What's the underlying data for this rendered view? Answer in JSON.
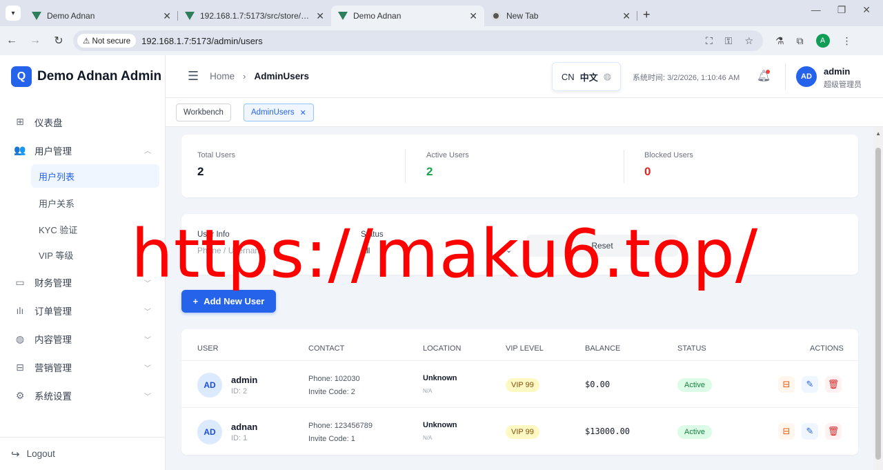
{
  "browser": {
    "tabs": [
      {
        "title": "Demo Adnan",
        "icon": "vue-icon"
      },
      {
        "title": "192.168.1.7:5173/src/store/auth",
        "icon": "vue-icon"
      },
      {
        "title": "Demo Adnan",
        "icon": "vue-icon"
      },
      {
        "title": "New Tab",
        "icon": "chrome-icon"
      }
    ],
    "security_label": "Not secure",
    "url": "192.168.1.7:5173/admin/users",
    "profile_initial": "A"
  },
  "sidebar": {
    "brand_logo": "Q",
    "brand_name": "Demo Adnan Admin",
    "items": [
      {
        "label": "仪表盘",
        "icon": "dashboard-icon"
      },
      {
        "label": "用户管理",
        "icon": "users-icon"
      },
      {
        "label": "财务管理",
        "icon": "wallet-icon"
      },
      {
        "label": "订单管理",
        "icon": "orders-icon"
      },
      {
        "label": "内容管理",
        "icon": "globe-icon"
      },
      {
        "label": "营销管理",
        "icon": "gift-icon"
      },
      {
        "label": "系统设置",
        "icon": "settings-icon"
      }
    ],
    "sub_items": [
      "用户列表",
      "用户关系",
      "KYC 验证",
      "VIP 等级"
    ],
    "logout": "Logout"
  },
  "header": {
    "breadcrumb_home": "Home",
    "breadcrumb_current": "AdminUsers",
    "lang_code": "CN",
    "lang_name": "中文",
    "system_time": "系统时间: 3/2/2026, 1:10:46 AM",
    "avatar_initials": "AD",
    "user_name": "admin",
    "user_role": "超级管理员"
  },
  "tags": {
    "workbench": "Workbench",
    "current": "AdminUsers"
  },
  "stats": [
    {
      "label": "Total Users",
      "value": "2",
      "color": "#111827"
    },
    {
      "label": "Active Users",
      "value": "2",
      "color": "#16a34a"
    },
    {
      "label": "Blocked Users",
      "value": "0",
      "color": "#dc2626"
    }
  ],
  "filters": {
    "user_info_label": "User Info",
    "user_info_placeholder": "Phone / Username",
    "status_label": "Status",
    "status_value": "All",
    "reset": "Reset"
  },
  "add_button": "Add New User",
  "table": {
    "headers": [
      "User",
      "Contact",
      "Location",
      "VIP Level",
      "Balance",
      "Status",
      "Actions"
    ],
    "rows": [
      {
        "initials": "AD",
        "name": "admin",
        "id": "ID: 2",
        "phone": "Phone: 102030",
        "invite": "Invite Code: 2",
        "location": "Unknown",
        "location_sub": "N/A",
        "vip": "VIP 99",
        "balance": "$0.00",
        "status": "Active"
      },
      {
        "initials": "AD",
        "name": "adnan",
        "id": "ID: 1",
        "phone": "Phone: 123456789",
        "invite": "Invite Code: 1",
        "location": "Unknown",
        "location_sub": "N/A",
        "vip": "VIP 99",
        "balance": "$13000.00",
        "status": "Active"
      }
    ]
  },
  "watermark": "https://maku6.top/"
}
